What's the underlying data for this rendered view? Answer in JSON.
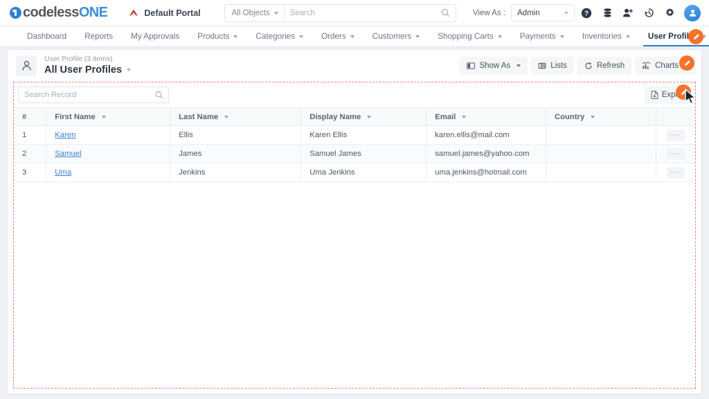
{
  "brand": {
    "name_dark": "codeless",
    "name_light": "ONE",
    "logo_icon": "circle-one-icon"
  },
  "topbar": {
    "portal_label": "Default Portal",
    "portal_icon": "portal-triangle-icon",
    "object_filter": "All Objects",
    "search_placeholder": "Search",
    "search_value": "",
    "search_icon": "search-icon",
    "view_as_label": "View As :",
    "view_as_value": "Admin",
    "icons": [
      "help-icon",
      "database-icon",
      "add-user-icon",
      "history-icon",
      "gear-icon",
      "avatar-icon"
    ]
  },
  "nav": {
    "items": [
      {
        "label": "Dashboard",
        "has_caret": false,
        "active": false
      },
      {
        "label": "Reports",
        "has_caret": false,
        "active": false
      },
      {
        "label": "My Approvals",
        "has_caret": false,
        "active": false
      },
      {
        "label": "Products",
        "has_caret": true,
        "active": false
      },
      {
        "label": "Categories",
        "has_caret": true,
        "active": false
      },
      {
        "label": "Orders",
        "has_caret": true,
        "active": false
      },
      {
        "label": "Customers",
        "has_caret": true,
        "active": false
      },
      {
        "label": "Shopping Carts",
        "has_caret": true,
        "active": false
      },
      {
        "label": "Payments",
        "has_caret": true,
        "active": false
      },
      {
        "label": "Inventories",
        "has_caret": true,
        "active": false
      },
      {
        "label": "User Profiles",
        "has_caret": true,
        "active": true
      }
    ],
    "edit_fab_icon": "pencil-icon"
  },
  "card": {
    "object_icon": "user-profile-icon",
    "subtitle": "User Profile (3 items)",
    "title": "All User Profiles",
    "buttons": [
      {
        "label": "Show As",
        "icon": "show-as-icon",
        "caret": true
      },
      {
        "label": "Lists",
        "icon": "lists-icon",
        "caret": false
      },
      {
        "label": "Refresh",
        "icon": "refresh-icon",
        "caret": false
      },
      {
        "label": "Charts",
        "icon": "charts-icon",
        "caret": true
      }
    ],
    "edit_fab_icon": "pencil-icon"
  },
  "toolbar": {
    "search_placeholder": "Search Record",
    "search_value": "",
    "search_icon": "search-icon",
    "export_label": "Export",
    "export_icon": "export-file-icon",
    "edit_fab_icon": "pencil-icon"
  },
  "table": {
    "columns": [
      {
        "label": "#",
        "sortable": false
      },
      {
        "label": "First Name",
        "sortable": true
      },
      {
        "label": "Last Name",
        "sortable": true
      },
      {
        "label": "Display Name",
        "sortable": true
      },
      {
        "label": "Email",
        "sortable": true
      },
      {
        "label": "Country",
        "sortable": true
      },
      {
        "label": "",
        "sortable": false
      }
    ],
    "rows": [
      {
        "n": "1",
        "first": "Karen",
        "last": "Ellis",
        "display": "Karen Ellis",
        "email": "karen.ellis@mail.com",
        "country": "",
        "actions": "···"
      },
      {
        "n": "2",
        "first": "Samuel",
        "last": "James",
        "display": "Samuel James",
        "email": "samuel.james@yahoo.com",
        "country": "",
        "actions": "···"
      },
      {
        "n": "3",
        "first": "Uma",
        "last": "Jenkins",
        "display": "Uma Jenkins",
        "email": "uma.jenkins@hotmail.com",
        "country": "",
        "actions": "···"
      }
    ]
  },
  "colors": {
    "brand_blue": "#3b8cd9",
    "accent_orange": "#f4722b",
    "link_blue": "#3b7fd4",
    "dashed_red": "#f08080",
    "active_underline": "#2b7fd4"
  },
  "cursor": {
    "icon": "mouse-pointer-icon"
  }
}
